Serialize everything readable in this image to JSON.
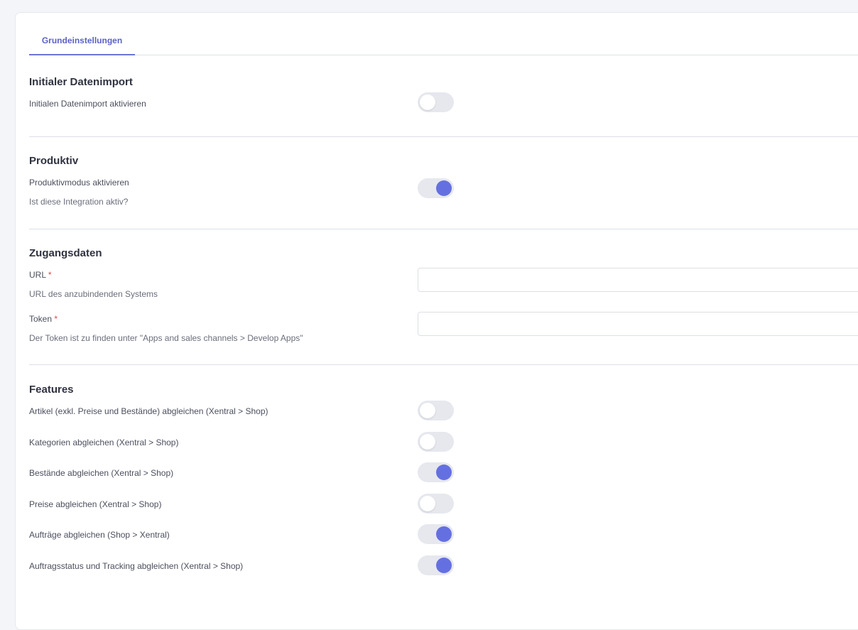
{
  "tabs": [
    {
      "label": "Grundeinstellungen",
      "active": true
    }
  ],
  "sections": {
    "import": {
      "title": "Initialer Datenimport",
      "toggle_label": "Initialen Datenimport aktivieren",
      "enabled": false
    },
    "produktiv": {
      "title": "Produktiv",
      "toggle_label": "Produktivmodus aktivieren",
      "hint": "Ist diese Integration aktiv?",
      "enabled": true
    },
    "zugang": {
      "title": "Zugangsdaten",
      "url": {
        "label": "URL",
        "required_mark": "*",
        "hint": "URL des anzubindenden Systems",
        "value": ""
      },
      "token": {
        "label": "Token",
        "required_mark": "*",
        "hint": "Der Token ist zu finden unter \"Apps and sales channels > Develop Apps\"",
        "value": ""
      }
    },
    "features": {
      "title": "Features",
      "items": [
        {
          "label": "Artikel (exkl. Preise und Bestände) abgleichen (Xentral > Shop)",
          "enabled": false
        },
        {
          "label": "Kategorien abgleichen (Xentral > Shop)",
          "enabled": false
        },
        {
          "label": "Bestände abgleichen (Xentral > Shop)",
          "enabled": true
        },
        {
          "label": "Preise abgleichen (Xentral > Shop)",
          "enabled": false
        },
        {
          "label": "Aufträge abgleichen (Shop > Xentral)",
          "enabled": true
        },
        {
          "label": "Auftragsstatus und Tracking abgleichen (Xentral > Shop)",
          "enabled": true
        }
      ]
    }
  },
  "colors": {
    "accent": "#6570e0",
    "tab_text": "#5a63c4",
    "required": "#e0454c"
  }
}
